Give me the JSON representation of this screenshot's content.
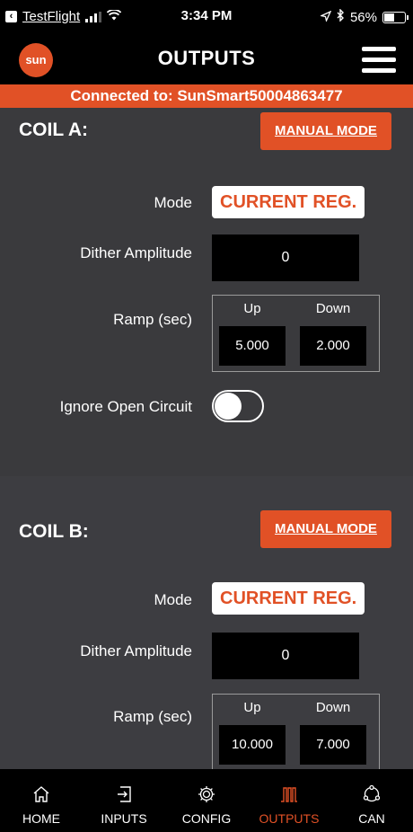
{
  "status_bar": {
    "back_app": "TestFlight",
    "time": "3:34 PM",
    "battery": "56%",
    "battery_level": 0.56
  },
  "nav": {
    "logo_text": "sun",
    "title": "OUTPUTS"
  },
  "connection": {
    "text": "Connected to: SunSmart50004863477"
  },
  "coils": [
    {
      "title": "COIL A:",
      "manual_mode_label": "MANUAL MODE",
      "mode_label": "Mode",
      "mode_value": "CURRENT REG.",
      "dither_label": "Dither Amplitude",
      "dither_value": "0",
      "ramp_label": "Ramp (sec)",
      "ramp_up_label": "Up",
      "ramp_down_label": "Down",
      "ramp_up_value": "5.000",
      "ramp_down_value": "2.000",
      "ignore_open_label": "Ignore Open Circuit",
      "ignore_open_on": false
    },
    {
      "title": "COIL B:",
      "manual_mode_label": "MANUAL MODE",
      "mode_label": "Mode",
      "mode_value": "CURRENT REG.",
      "dither_label": "Dither Amplitude",
      "dither_value": "0",
      "ramp_label": "Ramp (sec)",
      "ramp_up_label": "Up",
      "ramp_down_label": "Down",
      "ramp_up_value": "10.000",
      "ramp_down_value": "7.000"
    }
  ],
  "tabs": [
    {
      "label": "HOME",
      "icon": "home-icon",
      "active": false
    },
    {
      "label": "INPUTS",
      "icon": "inputs-icon",
      "active": false
    },
    {
      "label": "CONFIG",
      "icon": "gear-icon",
      "active": false
    },
    {
      "label": "OUTPUTS",
      "icon": "outputs-icon",
      "active": true
    },
    {
      "label": "CAN",
      "icon": "can-network-icon",
      "active": false
    }
  ],
  "colors": {
    "accent": "#e15126",
    "background": "#3a3a3d",
    "bar": "#000000"
  }
}
